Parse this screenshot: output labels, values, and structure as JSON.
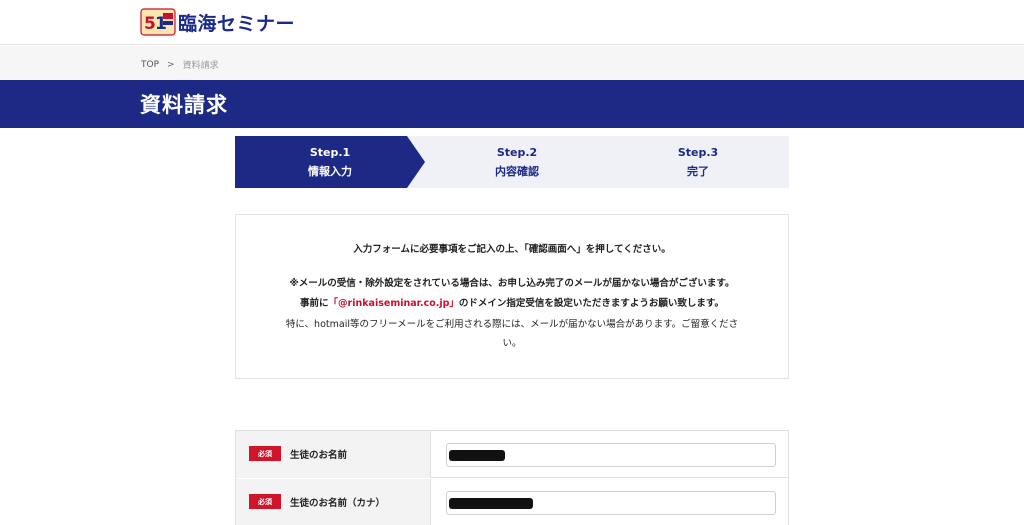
{
  "header": {
    "logo_text": "臨海セミナー",
    "logo_badge": "51"
  },
  "breadcrumb": {
    "home": "TOP",
    "separator": ">",
    "current": "資料請求"
  },
  "page": {
    "title": "資料請求"
  },
  "steps": [
    {
      "number": "Step.1",
      "label": "情報入力",
      "active": true
    },
    {
      "number": "Step.2",
      "label": "内容確認",
      "active": false
    },
    {
      "number": "Step.3",
      "label": "完了",
      "active": false
    }
  ],
  "notice": {
    "line1": "入力フォームに必要事項をご記入の上、「確認画面へ」を押してください。",
    "line2": "※メールの受信・除外設定をされている場合は、お申し込み完了のメールが届かない場合がございます。",
    "line3_prefix": "事前に",
    "line3_domain": "「@rinkaiseminar.co.jp」",
    "line3_suffix": "のドメイン指定受信を設定いただきますようお願い致します。",
    "line4": "特に、hotmail等のフリーメールをご利用される際には、メールが届かない場合があります。ご留意くださ",
    "line5": "い。"
  },
  "form": {
    "required_label": "必須",
    "fields": [
      {
        "label": "生徒のお名前",
        "value": ""
      },
      {
        "label": "生徒のお名前（カナ）",
        "value": ""
      }
    ]
  },
  "colors": {
    "brand_navy": "#1c2a86",
    "required_red": "#d0152a",
    "domain_red": "#c8102e"
  }
}
